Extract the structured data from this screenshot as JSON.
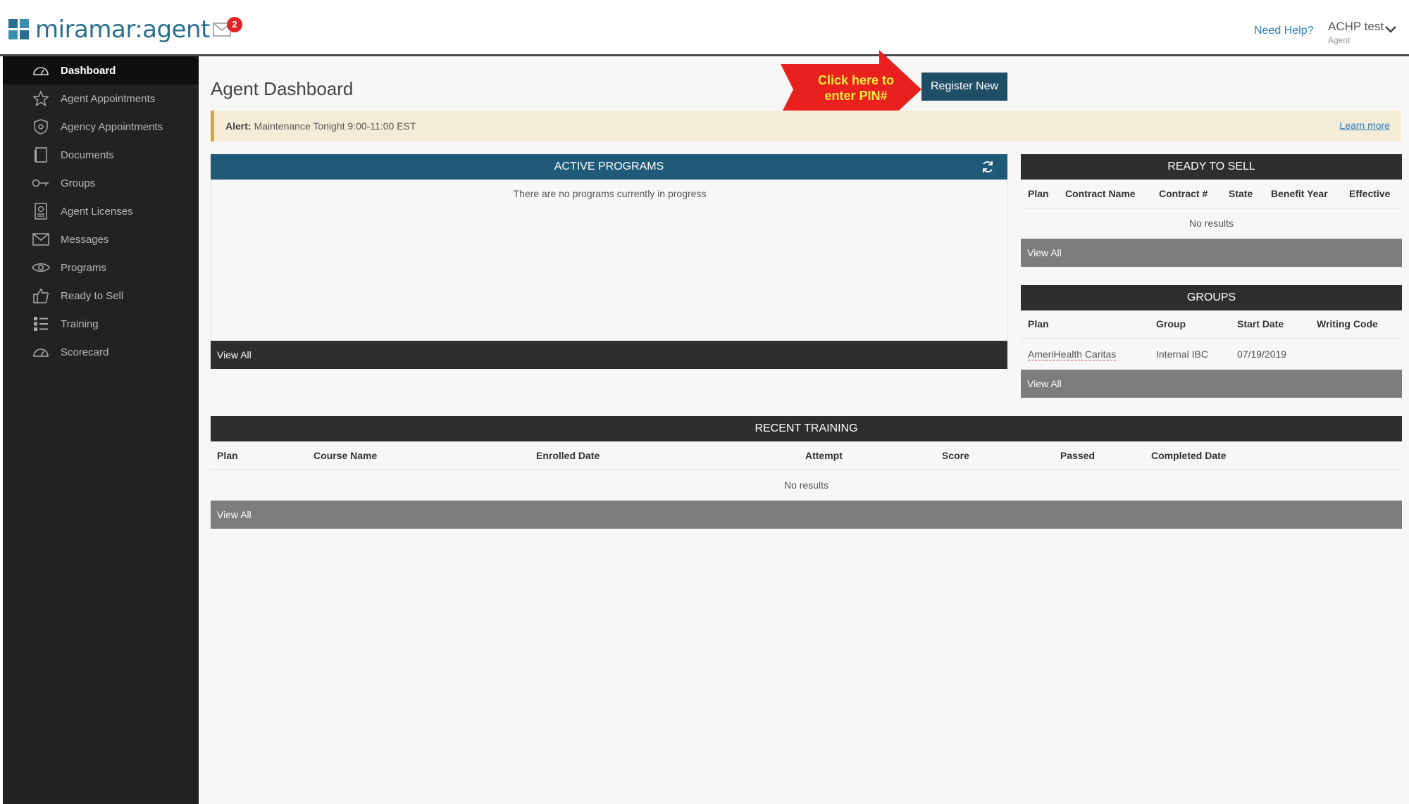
{
  "header": {
    "logo_brand": "miramar",
    "logo_suffix": ":agent",
    "mail_badge": "2",
    "need_help": "Need Help?",
    "user_name": "ACHP test",
    "user_role": "Agent"
  },
  "sidebar": {
    "items": [
      {
        "label": "Dashboard",
        "icon": "gauge-icon"
      },
      {
        "label": "Agent Appointments",
        "icon": "star-icon"
      },
      {
        "label": "Agency Appointments",
        "icon": "shield-icon"
      },
      {
        "label": "Documents",
        "icon": "document-icon"
      },
      {
        "label": "Groups",
        "icon": "key-icon"
      },
      {
        "label": "Agent Licenses",
        "icon": "license-icon"
      },
      {
        "label": "Messages",
        "icon": "envelope-icon"
      },
      {
        "label": "Programs",
        "icon": "eye-icon"
      },
      {
        "label": "Ready to Sell",
        "icon": "thumbs-up-icon"
      },
      {
        "label": "Training",
        "icon": "list-icon"
      },
      {
        "label": "Scorecard",
        "icon": "gauge-icon"
      }
    ]
  },
  "main": {
    "title": "Agent Dashboard",
    "register_button": "Register New",
    "callout_line1": "Click here to",
    "callout_line2": "enter PIN#",
    "alert": {
      "label": "Alert:",
      "message": "Maintenance Tonight 9:00-11:00 EST",
      "link": "Learn more"
    },
    "active_programs": {
      "title": "ACTIVE PROGRAMS",
      "empty": "There are no programs currently in progress",
      "view_all": "View All"
    },
    "ready_to_sell": {
      "title": "READY TO SELL",
      "columns": [
        "Plan",
        "Contract Name",
        "Contract #",
        "State",
        "Benefit Year",
        "Effective"
      ],
      "empty": "No results",
      "view_all": "View All"
    },
    "groups": {
      "title": "GROUPS",
      "columns": [
        "Plan",
        "Group",
        "Start Date",
        "Writing Code"
      ],
      "rows": [
        {
          "plan": "AmeriHealth Caritas",
          "group": "Internal IBC",
          "start_date": "07/19/2019",
          "writing_code": ""
        }
      ],
      "view_all": "View All"
    },
    "recent_training": {
      "title": "RECENT TRAINING",
      "columns": [
        "Plan",
        "Course Name",
        "Enrolled Date",
        "Attempt",
        "Score",
        "Passed",
        "Completed Date"
      ],
      "empty": "No results",
      "view_all": "View All"
    }
  },
  "colors": {
    "primary": "#1f5a78",
    "register_button": "#1f4f66",
    "sidebar_bg": "#222222",
    "alert_bg": "#f5ecd8",
    "callout_red": "#e8201e",
    "callout_text": "#ffec3a",
    "badge_red": "#e02424"
  }
}
